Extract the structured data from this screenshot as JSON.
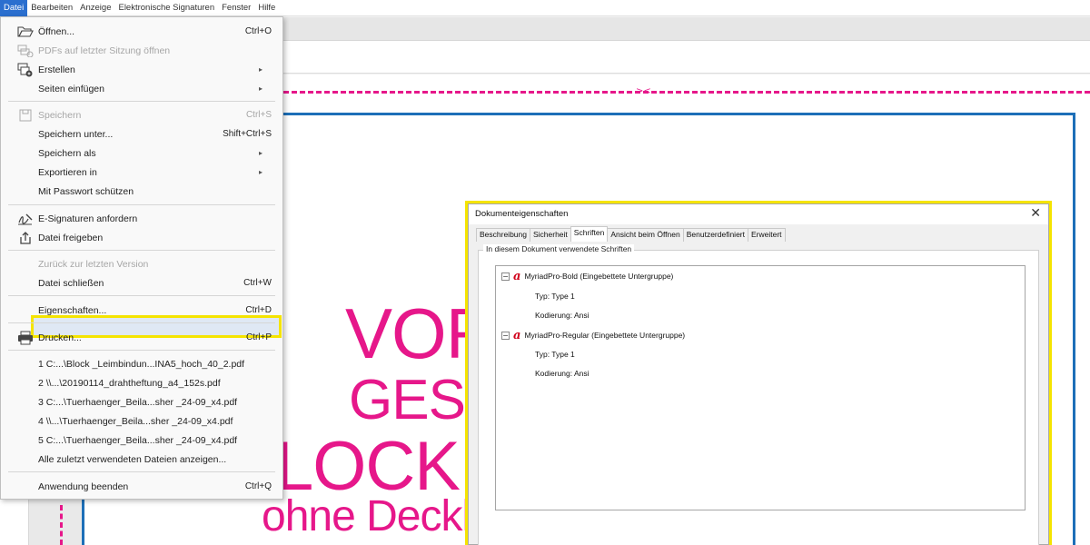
{
  "menubar": {
    "items": [
      "Datei",
      "Bearbeiten",
      "Anzeige",
      "Elektronische Signaturen",
      "Fenster",
      "Hilfe"
    ]
  },
  "file_menu": {
    "items": [
      {
        "label": "Öffnen...",
        "shortcut": "Ctrl+O",
        "icon": "folder-open-icon",
        "disabled": false
      },
      {
        "label": "PDFs auf letzter Sitzung öffnen",
        "shortcut": "",
        "icon": "recent-pdfs-icon",
        "disabled": true
      },
      {
        "label": "Erstellen",
        "shortcut": "",
        "icon": "create-icon",
        "submenu": true,
        "disabled": false
      },
      {
        "label": "Seiten einfügen",
        "shortcut": "",
        "submenu": true,
        "disabled": false
      },
      {
        "label": "Speichern",
        "shortcut": "Ctrl+S",
        "icon": "save-icon",
        "disabled": true
      },
      {
        "label": "Speichern unter...",
        "shortcut": "Shift+Ctrl+S",
        "disabled": false
      },
      {
        "label": "Speichern als",
        "shortcut": "",
        "submenu": true,
        "disabled": false
      },
      {
        "label": "Exportieren in",
        "shortcut": "",
        "submenu": true,
        "disabled": false
      },
      {
        "label": "Mit Passwort schützen",
        "shortcut": "",
        "disabled": false
      },
      {
        "label": "E-Signaturen anfordern",
        "shortcut": "",
        "icon": "signature-icon",
        "disabled": false
      },
      {
        "label": "Datei freigeben",
        "shortcut": "",
        "icon": "share-icon",
        "disabled": false
      },
      {
        "label": "Zurück zur letzten Version",
        "shortcut": "",
        "disabled": true
      },
      {
        "label": "Datei schließen",
        "shortcut": "Ctrl+W",
        "disabled": false
      },
      {
        "label": "Eigenschaften...",
        "shortcut": "Ctrl+D",
        "highlighted": true,
        "disabled": false
      },
      {
        "label": "Drucken...",
        "shortcut": "Ctrl+P",
        "icon": "printer-icon",
        "disabled": false
      },
      {
        "label": "1 C:...\\Block _Leimbindun...INA5_hoch_40_2.pdf",
        "shortcut": "",
        "disabled": false
      },
      {
        "label": "2 \\\\...\\20190114_drahtheftung_a4_152s.pdf",
        "shortcut": "",
        "disabled": false
      },
      {
        "label": "3 C:...\\Tuerhaenger_Beila...sher _24-09_x4.pdf",
        "shortcut": "",
        "disabled": false
      },
      {
        "label": "4 \\\\...\\Tuerhaenger_Beila...sher _24-09_x4.pdf",
        "shortcut": "",
        "disabled": false
      },
      {
        "label": "5 C:...\\Tuerhaenger_Beila...sher _24-09_x4.pdf",
        "shortcut": "",
        "disabled": false
      },
      {
        "label": "Alle zuletzt verwendeten Dateien anzeigen...",
        "shortcut": "",
        "disabled": false
      },
      {
        "label": "Anwendung beenden",
        "shortcut": "Ctrl+Q",
        "disabled": false
      }
    ]
  },
  "document": {
    "line1": "VOR",
    "line2": "GEST",
    "line3": "LOCK M",
    "line4": "ohne Deckl",
    "accent_color": "#e6178a",
    "frame_color": "#1d6fb8"
  },
  "dialog": {
    "title": "Dokumenteigenschaften",
    "close_glyph": "✕",
    "tabs": [
      "Beschreibung",
      "Sicherheit",
      "Schriften",
      "Ansicht beim Öffnen",
      "Benutzerdefiniert",
      "Erweitert"
    ],
    "active_tab": "Schriften",
    "group_label": "In diesem Dokument verwendete Schriften",
    "fonts": [
      {
        "name": "MyriadPro-Bold (Eingebettete Untergruppe)",
        "type": "Typ: Type 1",
        "encoding": "Kodierung: Ansi"
      },
      {
        "name": "MyriadPro-Regular (Eingebettete Untergruppe)",
        "type": "Typ: Type 1",
        "encoding": "Kodierung: Ansi"
      }
    ]
  },
  "highlight_color": "#f5e400"
}
